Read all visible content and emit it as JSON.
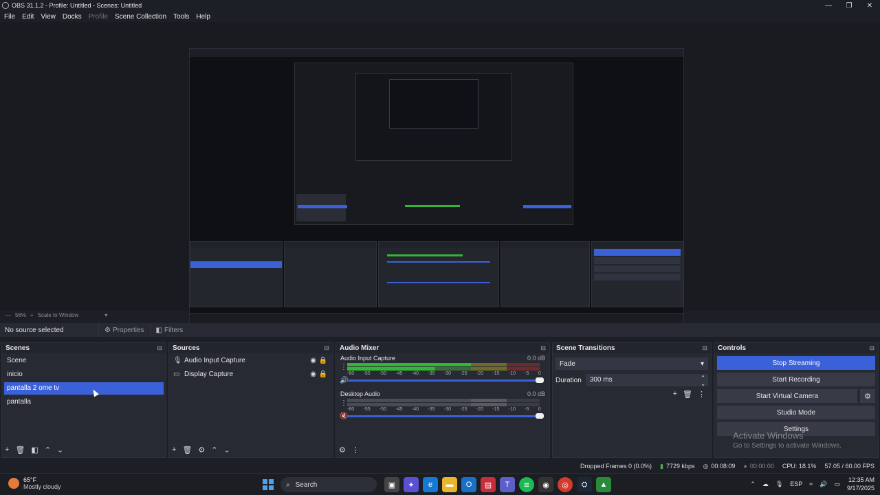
{
  "window": {
    "title": "OBS 31.1.2 - Profile: Untitled - Scenes: Untitled",
    "minimize": "—",
    "maximize": "❐",
    "close": "✕"
  },
  "menu": {
    "file": "File",
    "edit": "Edit",
    "view": "View",
    "docks": "Docks",
    "profile": "Profile",
    "scene_collection": "Scene Collection",
    "tools": "Tools",
    "help": "Help"
  },
  "preview": {
    "zoom": "56%",
    "plus": "+",
    "scale_mode": "Scale to Window"
  },
  "source_toolbar": {
    "no_source": "No source selected",
    "properties": "Properties",
    "filters": "Filters"
  },
  "scenes": {
    "title": "Scenes",
    "items": [
      {
        "label": "Scene"
      },
      {
        "label": "inicio"
      },
      {
        "label": "pantalla 2 ome tv"
      },
      {
        "label": "pantalla"
      }
    ]
  },
  "sources": {
    "title": "Sources",
    "items": [
      {
        "label": "Audio Input Capture",
        "icon": "microphone-icon"
      },
      {
        "label": "Display Capture",
        "icon": "monitor-icon"
      }
    ]
  },
  "mixer": {
    "title": "Audio Mixer",
    "ticks": [
      "-60",
      "-55",
      "-50",
      "-45",
      "-40",
      "-35",
      "-30",
      "-25",
      "-20",
      "-15",
      "-10",
      "-5",
      "0"
    ],
    "channels": [
      {
        "name": "Audio Input Capture",
        "db": "0.0 dB",
        "muted": false
      },
      {
        "name": "Desktop Audio",
        "db": "0.0 dB",
        "muted": true
      }
    ]
  },
  "transitions": {
    "title": "Scene Transitions",
    "selected": "Fade",
    "duration_label": "Duration",
    "duration_value": "300 ms"
  },
  "controls": {
    "title": "Controls",
    "stop_streaming": "Stop Streaming",
    "start_recording": "Start Recording",
    "start_virtual_camera": "Start Virtual Camera",
    "studio_mode": "Studio Mode",
    "settings": "Settings"
  },
  "watermark": {
    "line1": "Activate Windows",
    "line2": "Go to Settings to activate Windows."
  },
  "status": {
    "dropped": "Dropped Frames 0 (0.0%)",
    "bitrate": "7729 kbps",
    "stream_time": "00:08:09",
    "rec_time": "00:00:00",
    "cpu": "CPU: 18.1%",
    "fps": "57.05 / 60.00 FPS"
  },
  "taskbar": {
    "temp": "65°F",
    "weather": "Mostly cloudy",
    "search": "Search",
    "lang": "ESP",
    "time": "12:35 AM",
    "date": "9/17/2025"
  },
  "colors": {
    "accent": "#3b61d8",
    "meter_green": "#35b535",
    "meter_yellow": "#c9a227",
    "meter_red": "#c03838"
  }
}
